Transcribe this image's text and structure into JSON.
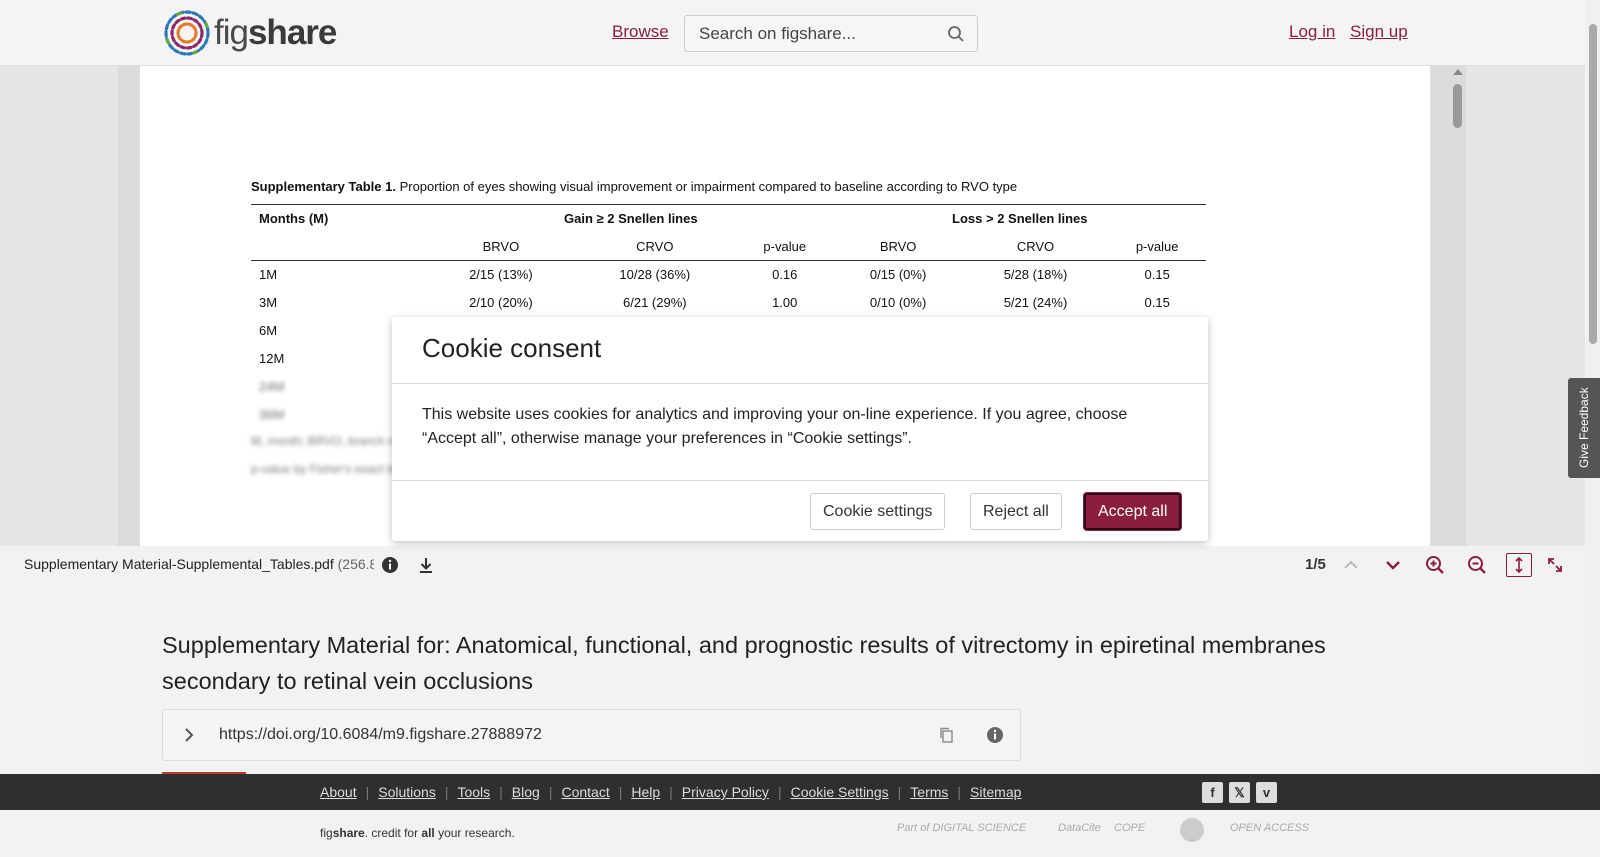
{
  "header": {
    "logo_text_light": "fig",
    "logo_text_bold": "share",
    "browse": "Browse",
    "search_placeholder": "Search on figshare...",
    "login": "Log in",
    "signup": "Sign up"
  },
  "document": {
    "caption_bold": "Supplementary Table 1.",
    "caption_text": " Proportion of eyes showing visual improvement or impairment compared to baseline according to RVO type",
    "header_row1": [
      "Months (M)",
      "Gain ≥ 2 Snellen lines",
      "Loss > 2 Snellen lines"
    ],
    "header_row2": [
      "",
      "BRVO",
      "CRVO",
      "p-value",
      "BRVO",
      "CRVO",
      "p-value"
    ],
    "rows": [
      [
        "1M",
        "2/15 (13%)",
        "10/28 (36%)",
        "0.16",
        "0/15 (0%)",
        "5/28 (18%)",
        "0.15"
      ],
      [
        "3M",
        "2/10 (20%)",
        "6/21 (29%)",
        "1.00",
        "0/10 (0%)",
        "5/21 (24%)",
        "0.15"
      ],
      [
        "6M",
        "",
        "",
        "",
        "",
        "",
        ""
      ],
      [
        "12M",
        "",
        "",
        "",
        "",
        "",
        ""
      ],
      [
        "24M",
        "",
        "",
        "",
        "",
        "",
        ""
      ],
      [
        "36M",
        "",
        "",
        "",
        "",
        "",
        ""
      ]
    ],
    "footnote1": "M, month; BRVO, branch retinal vein occlusion",
    "footnote2": "p-value by Fisher's exact test"
  },
  "viewer_toolbar": {
    "filename": "Supplementary Material-Supplemental_Tables.pdf",
    "filesize": " (256.8",
    "page_count": "1/5"
  },
  "article": {
    "title": "Supplementary Material for: Anatomical, functional, and prognostic results of vitrectomy in epiretinal membranes secondary to retinal vein occlusions",
    "doi": "https://doi.org/10.6084/m9.figshare.27888972"
  },
  "footer": {
    "links": [
      "About",
      "Solutions",
      "Tools",
      "Blog",
      "Contact",
      "Help",
      "Privacy Policy",
      "Cookie Settings",
      "Terms",
      "Sitemap"
    ],
    "tagline_pre": "fig",
    "tagline_bold": "share",
    "tagline_mid": ". credit for ",
    "tagline_all": "all",
    "tagline_end": " your research.",
    "partner_digital_science": "Part of DIGITAL SCIENCE",
    "partner_datacite": "DataCite",
    "partner_cope": "COPE",
    "partner_open_access": "OPEN ACCESS"
  },
  "feedback": {
    "label": "Give Feedback"
  },
  "cookie_modal": {
    "title": "Cookie consent",
    "body": "This website uses cookies for analytics and improving your on-line experience. If you agree, choose “Accept all”, otherwise manage your preferences in “Cookie settings”.",
    "settings_btn": "Cookie settings",
    "reject_btn": "Reject all",
    "accept_btn": "Accept all"
  },
  "colors": {
    "brand": "#8b1e3f",
    "footer_dark": "#2f2f2f"
  }
}
